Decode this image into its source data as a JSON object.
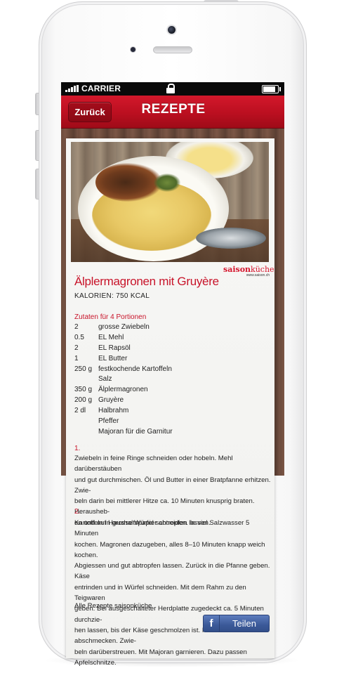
{
  "statusbar": {
    "carrier": "CARRIER"
  },
  "navbar": {
    "back_label": "Zurück",
    "title": "REZEPTE"
  },
  "brand": {
    "name_part1": "saison",
    "name_part2": "küche",
    "url": "www.saison.ch"
  },
  "recipe": {
    "title": "Älplermagronen mit Gruyère",
    "calories_label": "Kalorien:",
    "calories_value": "750 kcal",
    "ingredients_heading": "Zutaten für 4 Portionen",
    "ingredients": [
      {
        "qty": "2",
        "name": "grosse Zwiebeln"
      },
      {
        "qty": "0.5",
        "name": "EL Mehl"
      },
      {
        "qty": "2",
        "name": "EL Rapsöl"
      },
      {
        "qty": "1",
        "name": "EL Butter"
      },
      {
        "qty": "250 g",
        "name": "festkochende Kartoffeln"
      },
      {
        "qty": "",
        "name": "Salz"
      },
      {
        "qty": "350 g",
        "name": "Älplermagronen"
      },
      {
        "qty": "200 g",
        "name": "Gruyère"
      },
      {
        "qty": "2 dl",
        "name": "Halbrahm"
      },
      {
        "qty": "",
        "name": "Pfeffer"
      },
      {
        "qty": "",
        "name": "Majoran für die Garnitur"
      }
    ],
    "steps": [
      {
        "number": "1.",
        "text": "Zwiebeln in feine Ringe schneiden oder hobeln. Mehl darüberstäuben\nund gut durchmischen. Öl und Butter in einer Bratpfanne erhitzen. Zwie-\nbeln darin bei mittlerer Hitze ca. 10 Minuten knusprig braten. Herausheb-\nen und auf Haushaltspapier abtropfen lassen."
      },
      {
        "number": "2.",
        "text": "Kartoffeln in grosse Würfel schneiden. In viel Salzwasser 5 Minuten\nkochen. Magronen dazugeben, alles 8–10 Minuten knapp weich kochen.\nAbgiessen und gut abtropfen lassen. Zurück in die Pfanne geben. Käse\nentrinden und in Würfel schneiden. Mit dem Rahm zu den Teigwaren\ngeben. Bei ausgeschalteter Herdplatte zugedeckt ca. 5 Minuten durchzie-\nhen lassen, bis der Käse geschmolzen ist. Mit Pfeffer abschmecken. Zwie-\nbeln darüberstreuen. Mit Majoran garnieren. Dazu passen Apfelschnitze."
      }
    ],
    "footer_note": "Alle Rezepte saisonküche"
  },
  "share": {
    "icon_glyph": "f",
    "label": "Teilen",
    "brand_color": "#3b5998"
  },
  "colors": {
    "accent": "#c8142a",
    "navbar": "#bb0f20"
  }
}
